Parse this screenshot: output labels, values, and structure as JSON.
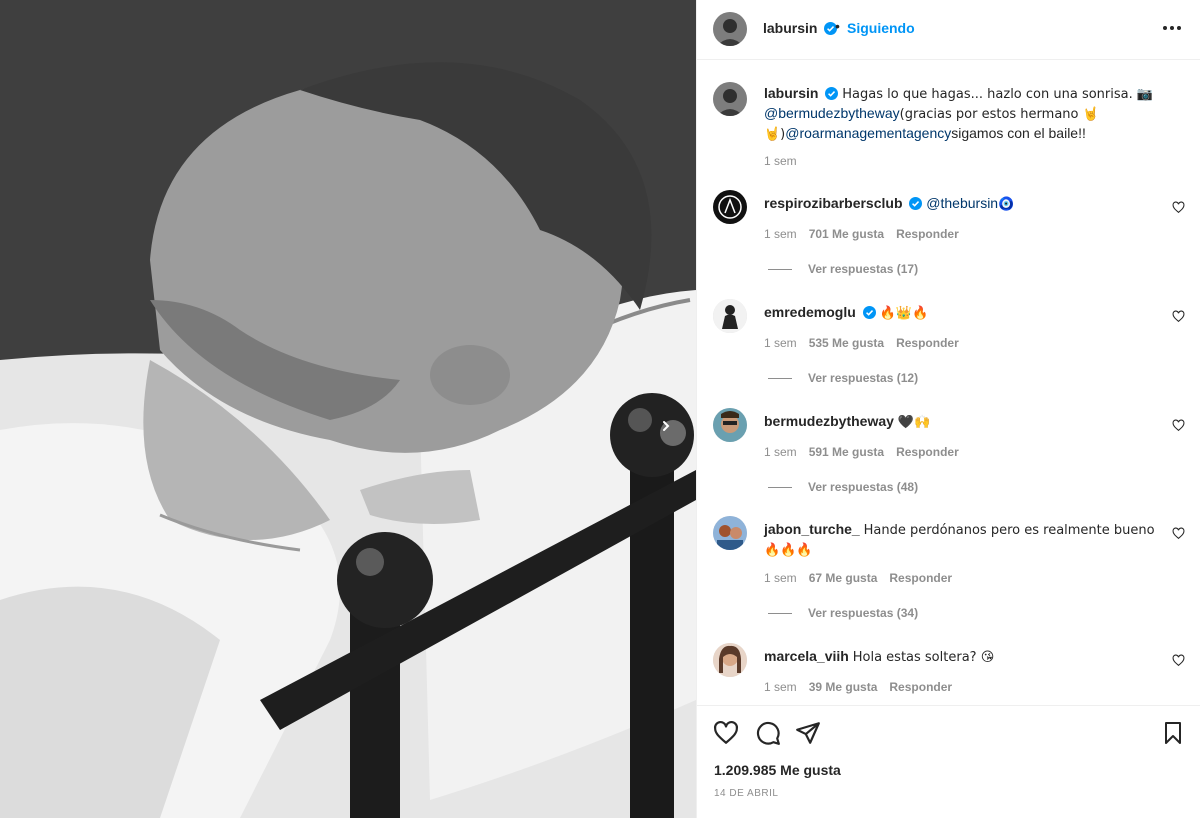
{
  "post": {
    "username": "labursin",
    "follow_status": "Siguiendo",
    "separator": "•",
    "caption": {
      "text_1": "Hagas lo que hagas... hazlo con una sonrisa. 📷",
      "mention_1": "@bermudezbytheway",
      "text_2": "(gracias por estos hermano 🤘🤘)",
      "mention_2": "@roarmanagementagency",
      "text_3": "sigamos con el baile!!",
      "time": "1 sem"
    },
    "likes": "1.209.985 Me gusta",
    "date": "14 de abril"
  },
  "comments": [
    {
      "username": "respirozibarbersclub",
      "verified": true,
      "mention": "@thebursin",
      "text": "🧿",
      "time": "1 sem",
      "likes": "701 Me gusta",
      "reply": "Responder",
      "replies": "Ver respuestas (17)"
    },
    {
      "username": "emredemoglu",
      "verified": true,
      "mention": "",
      "text": "🔥👑🔥",
      "time": "1 sem",
      "likes": "535 Me gusta",
      "reply": "Responder",
      "replies": "Ver respuestas (12)"
    },
    {
      "username": "bermudezbytheway",
      "verified": false,
      "mention": "",
      "text": "🖤🙌",
      "time": "1 sem",
      "likes": "591 Me gusta",
      "reply": "Responder",
      "replies": "Ver respuestas (48)"
    },
    {
      "username": "jabon_turche_",
      "verified": false,
      "mention": "",
      "text": "Hande perdónanos pero es realmente bueno 🔥🔥🔥",
      "time": "1 sem",
      "likes": "67 Me gusta",
      "reply": "Responder",
      "replies": "Ver respuestas (34)"
    },
    {
      "username": "marcela_viih",
      "verified": false,
      "mention": "",
      "text": "Hola estas soltera? 😘",
      "time": "1 sem",
      "likes": "39 Me gusta",
      "reply": "Responder",
      "replies": ""
    }
  ],
  "icons": {
    "like": "heart-icon",
    "comment": "comment-icon",
    "share": "share-icon",
    "save": "bookmark-icon",
    "more": "more-options-icon",
    "next": "chevron-right-icon",
    "verified": "verified-badge-icon"
  },
  "colors": {
    "link": "#0095f6",
    "mention": "#00376b",
    "verified": "#0095f6",
    "muted": "#8e8e8e"
  }
}
